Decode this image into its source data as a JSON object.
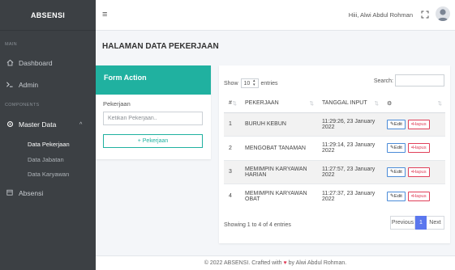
{
  "sidebar": {
    "brand": "ABSENSI",
    "section_main": "MAIN",
    "section_components": "COMPONENTS",
    "items": [
      {
        "label": "Dashboard",
        "icon": "home-icon"
      },
      {
        "label": "Admin",
        "icon": "admin-icon"
      },
      {
        "label": "Master Data",
        "icon": "gear-icon"
      },
      {
        "label": "Absensi",
        "icon": "calendar-icon"
      }
    ],
    "sub_items": [
      "Data Pekerjaan",
      "Data Jabatan",
      "Data Karyawan"
    ]
  },
  "topbar": {
    "menu_icon": "hamburger-icon",
    "user_name": "Hiii, Alwi Abdul Rohman",
    "fullscreen_icon": "fullscreen-icon"
  },
  "page": {
    "title": "HALAMAN DATA PEKERJAAN"
  },
  "form": {
    "title": "Form Action",
    "label": "Pekerjaan",
    "placeholder": "Ketikan Pekerjaan..",
    "add_button": "+ Pekerjaan"
  },
  "table": {
    "show_label": "Show",
    "entries_value": "10",
    "entries_label": "entries",
    "search_label": "Search:",
    "headers": [
      "#",
      "PEKERJAAN",
      "TANGGAL INPUT",
      "⚙"
    ],
    "rows": [
      {
        "no": "1",
        "pekerjaan": "BURUH KEBUN",
        "tanggal": "11:29:26, 23 January 2022"
      },
      {
        "no": "2",
        "pekerjaan": "MENGOBAT TANAMAN",
        "tanggal": "11:29:14, 23 January 2022"
      },
      {
        "no": "3",
        "pekerjaan": "MEMIMPIN KARYAWAN HARIAN",
        "tanggal": "11:27:57, 23 January 2022"
      },
      {
        "no": "4",
        "pekerjaan": "MEMIMPIN KARYAWAN OBAT",
        "tanggal": "11:27:37, 23 January 2022"
      }
    ],
    "edit_label": "Edit",
    "delete_label": "Hapus",
    "showing": "Showing 1 to 4 of 4 entries",
    "pagination": {
      "previous": "Previous",
      "current": "1",
      "next": "Next"
    }
  },
  "footer": {
    "prefix": "© 2022 ABSENSI. Crafted with",
    "suffix": "by Alwi Abdul Rohman."
  },
  "colors": {
    "accent": "#20b1a0",
    "sidebar_bg": "#3c4044",
    "pagination_active": "#5b77ee",
    "delete": "#e0405a",
    "edit": "#4c8cd8"
  }
}
